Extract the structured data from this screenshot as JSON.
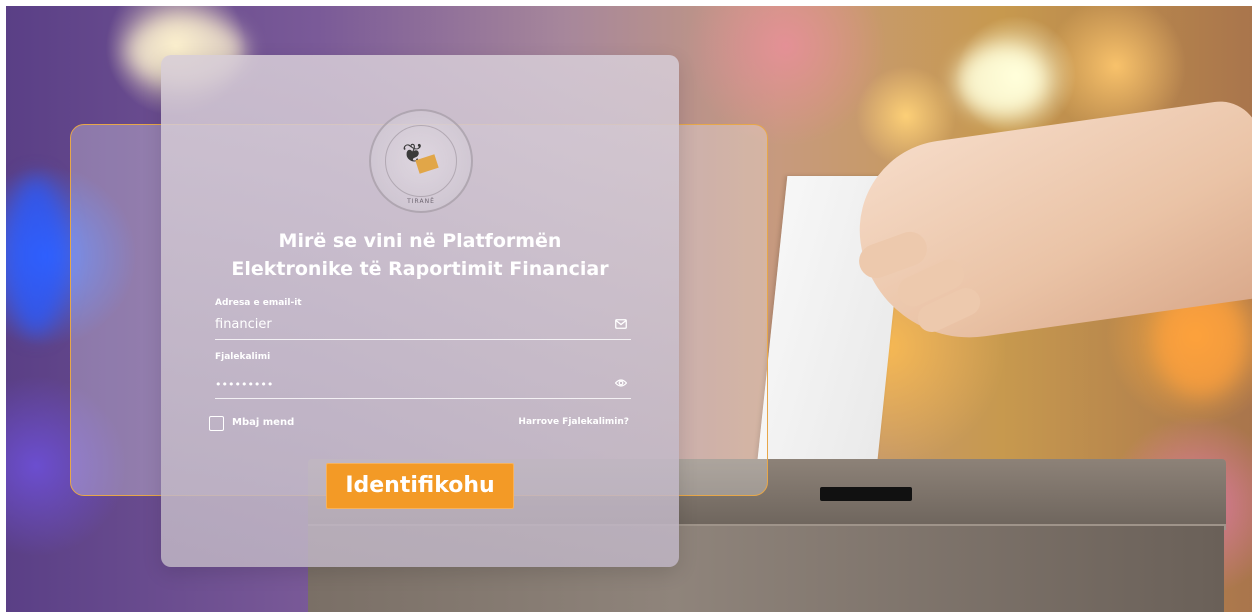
{
  "seal": {
    "city_text": "TIRANË"
  },
  "title": {
    "line1": "Mirë se vini në Platformën",
    "line2": "Elektronike të Raportimit Financiar"
  },
  "email": {
    "label": "Adresa e email-it",
    "value": "financier",
    "icon": "mail-icon"
  },
  "password": {
    "label": "Fjalekalimi",
    "value": "•••••••••",
    "icon": "eye-icon"
  },
  "remember_label": "Mbaj mend",
  "forgot_label": "Harrove Fjalekalimin?",
  "login_label": "Identifikohu",
  "colors": {
    "accent": "#f39a26",
    "card_border": "#e7a74a"
  }
}
